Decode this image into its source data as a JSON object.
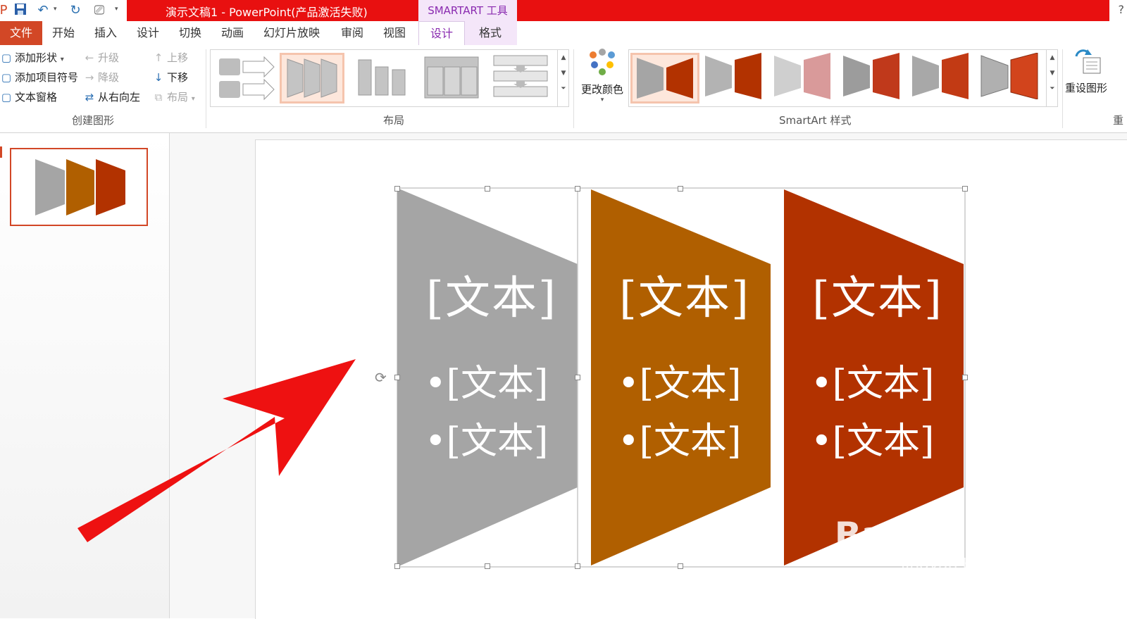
{
  "window": {
    "title": "演示文稿1 -  PowerPoint(产品激活失败)",
    "contextual_tool": "SMARTART 工具",
    "help": "?"
  },
  "tabs": [
    {
      "label": "文件"
    },
    {
      "label": "开始"
    },
    {
      "label": "插入"
    },
    {
      "label": "设计"
    },
    {
      "label": "切换"
    },
    {
      "label": "动画"
    },
    {
      "label": "幻灯片放映"
    },
    {
      "label": "审阅"
    },
    {
      "label": "视图"
    },
    {
      "label": "设计"
    },
    {
      "label": "格式"
    }
  ],
  "ribbon": {
    "create_graphic": {
      "label": "创建图形",
      "add_shape": "添加形状",
      "add_bullet": "添加项目符号",
      "text_pane": "文本窗格",
      "promote": "升级",
      "demote": "降级",
      "right_to_left": "从右向左",
      "move_up": "上移",
      "move_down": "下移",
      "layout": "布局"
    },
    "layouts": {
      "label": "布局"
    },
    "styles": {
      "label": "SmartArt 样式",
      "change_colors": "更改颜色"
    },
    "reset": {
      "label": "重设图形",
      "group_label": "重"
    }
  },
  "slide": {
    "columns": [
      {
        "title": "[文本]",
        "bullets": [
          "•[文本]",
          "•[文本]"
        ],
        "color": "#a5a5a5"
      },
      {
        "title": "[文本]",
        "bullets": [
          "•[文本]",
          "•[文本]"
        ],
        "color": "#b05f00"
      },
      {
        "title": "[文本]",
        "bullets": [
          "•[文本]",
          "•[文本]"
        ],
        "color": "#b23200"
      }
    ],
    "watermark": "Bai du 经验",
    "watermark_url": "jingyan.baidu.com"
  },
  "colors": {
    "title_bar": "#e81010",
    "file_tab": "#d24726",
    "contextual": "#8a2bb0",
    "arrow": "#ee1111"
  }
}
